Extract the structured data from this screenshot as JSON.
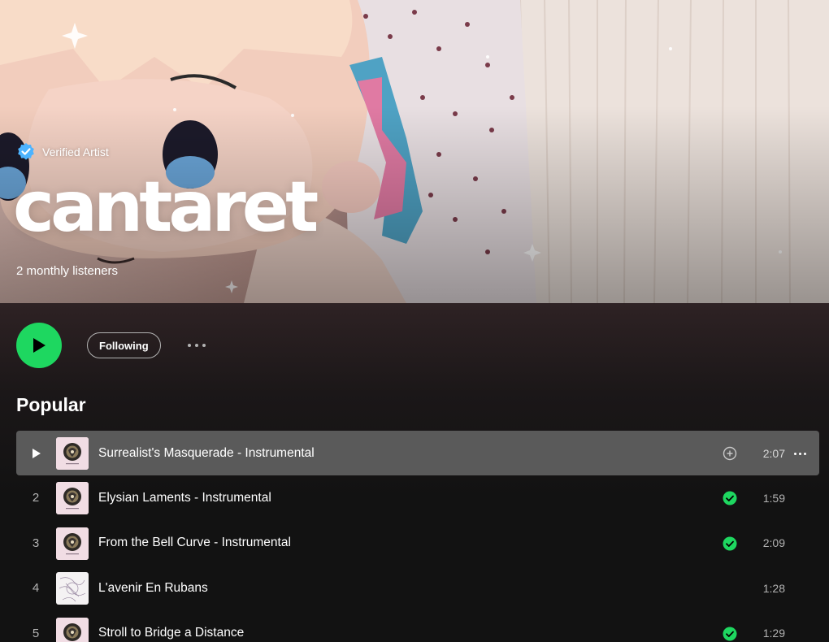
{
  "artist": {
    "verified_label": "Verified Artist",
    "name": "cantaret",
    "monthly_listeners": "2 monthly listeners"
  },
  "actions": {
    "follow_label": "Following"
  },
  "popular": {
    "heading": "Popular",
    "tracks": [
      {
        "num": "1",
        "title": "Surrealist's Masquerade - Instrumental",
        "duration": "2:07",
        "status": "add",
        "hover": true,
        "cover": "plush-cover"
      },
      {
        "num": "2",
        "title": "Elysian Laments - Instrumental",
        "duration": "1:59",
        "status": "saved",
        "hover": false,
        "cover": "plush-cover"
      },
      {
        "num": "3",
        "title": "From the Bell Curve - Instrumental",
        "duration": "2:09",
        "status": "saved",
        "hover": false,
        "cover": "plush-cover"
      },
      {
        "num": "4",
        "title": "L'avenir En Rubans",
        "duration": "1:28",
        "status": "none",
        "hover": false,
        "cover": "sketch-cover"
      },
      {
        "num": "5",
        "title": "Stroll to Bridge a Distance",
        "duration": "1:29",
        "status": "saved",
        "hover": false,
        "cover": "plush-cover"
      }
    ]
  },
  "colors": {
    "accent_green": "#1ed760",
    "verified_blue": "#4cb3ff",
    "row_hover": "#5a5a5a",
    "muted_text": "#b3b3b3",
    "background": "#121212"
  }
}
